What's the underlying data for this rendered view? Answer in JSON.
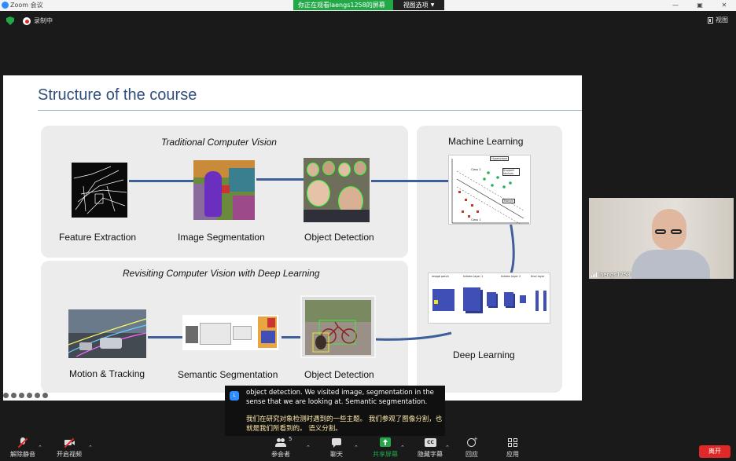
{
  "window": {
    "title": "Zoom 会议",
    "controls": [
      "—",
      "▢",
      "▣",
      "✕"
    ]
  },
  "share_banner": {
    "text": "你正在观看laengs1258的屏幕",
    "view_options": "视图选项"
  },
  "status": {
    "recording": "录制中",
    "view_label": "视图"
  },
  "slide": {
    "title": "Structure of the course",
    "traditional": {
      "heading": "Traditional Computer Vision",
      "items": [
        "Feature Extraction",
        "Image Segmentation",
        "Object Detection"
      ]
    },
    "deep": {
      "heading": "Revisiting Computer Vision with Deep Learning",
      "items": [
        "Motion & Tracking",
        "Semantic Segmentation",
        "Object Detection"
      ]
    },
    "right": {
      "ml": "Machine Learning",
      "dl": "Deep Learning"
    },
    "diagram_labels": {
      "hyperplane": "Hyperplane",
      "class2": "Class 2",
      "support": "Support Vectors",
      "margin": "Margin",
      "class1": "Class 1",
      "cnn_input": "image patch",
      "cnn_h1": "hidden layer 1",
      "cnn_h2": "hidden layer 2",
      "cnn_out": "final layer"
    }
  },
  "participant": {
    "name": "laengs1258"
  },
  "caption": {
    "avatar_letter": "L",
    "english": "object detection. We visited image, segmentation in the sense that we are looking at. Semantic segmentation.",
    "chinese": "我们在研究对象检测时遇到的一些主题。 我们参观了图像分割，也就是我们所看到的。 语义分割。"
  },
  "toolbar": {
    "unmute": "解除静音",
    "start_video": "开启视频",
    "participants": "参会者",
    "participant_count": "5",
    "chat": "聊天",
    "share": "共享屏幕",
    "captions": "隐藏字幕",
    "reactions": "回应",
    "apps": "应用",
    "leave": "离开"
  },
  "colors": {
    "accent_green": "#23a848",
    "leave_red": "#e02828",
    "connector_blue": "#3f5f9a",
    "title_blue": "#2f4f7a"
  }
}
